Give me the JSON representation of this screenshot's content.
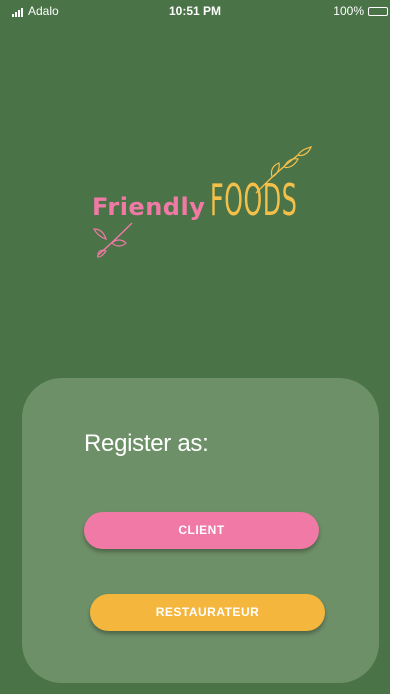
{
  "status_bar": {
    "carrier": "Adalo",
    "time": "10:51 PM",
    "battery": "100%"
  },
  "logo": {
    "word1": "Friendly",
    "word2": "FOODS",
    "colors": {
      "pink": "#f07aa5",
      "yellow": "#f5c04a"
    }
  },
  "register_card": {
    "title": "Register as:",
    "buttons": {
      "client": "CLIENT",
      "restaurateur": "RESTAURATEUR"
    }
  },
  "colors": {
    "background": "#4a7347",
    "card": "#6e9068",
    "client_button": "#f07aa5",
    "restaurateur_button": "#f5b63d"
  }
}
